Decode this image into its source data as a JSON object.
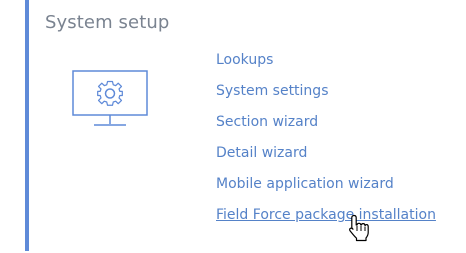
{
  "section": {
    "title": "System setup",
    "accent_color": "#5f8ad8",
    "icon": "monitor-gear-icon"
  },
  "links": [
    {
      "label": "Lookups"
    },
    {
      "label": "System settings"
    },
    {
      "label": "Section wizard"
    },
    {
      "label": "Detail wizard"
    },
    {
      "label": "Mobile application wizard"
    },
    {
      "label": "Field Force package installation",
      "hovered": true
    }
  ],
  "colors": {
    "link": "#5582c8",
    "title": "#7a8390",
    "icon": "#5f8ad8"
  },
  "cursor": "hand-pointer-icon"
}
